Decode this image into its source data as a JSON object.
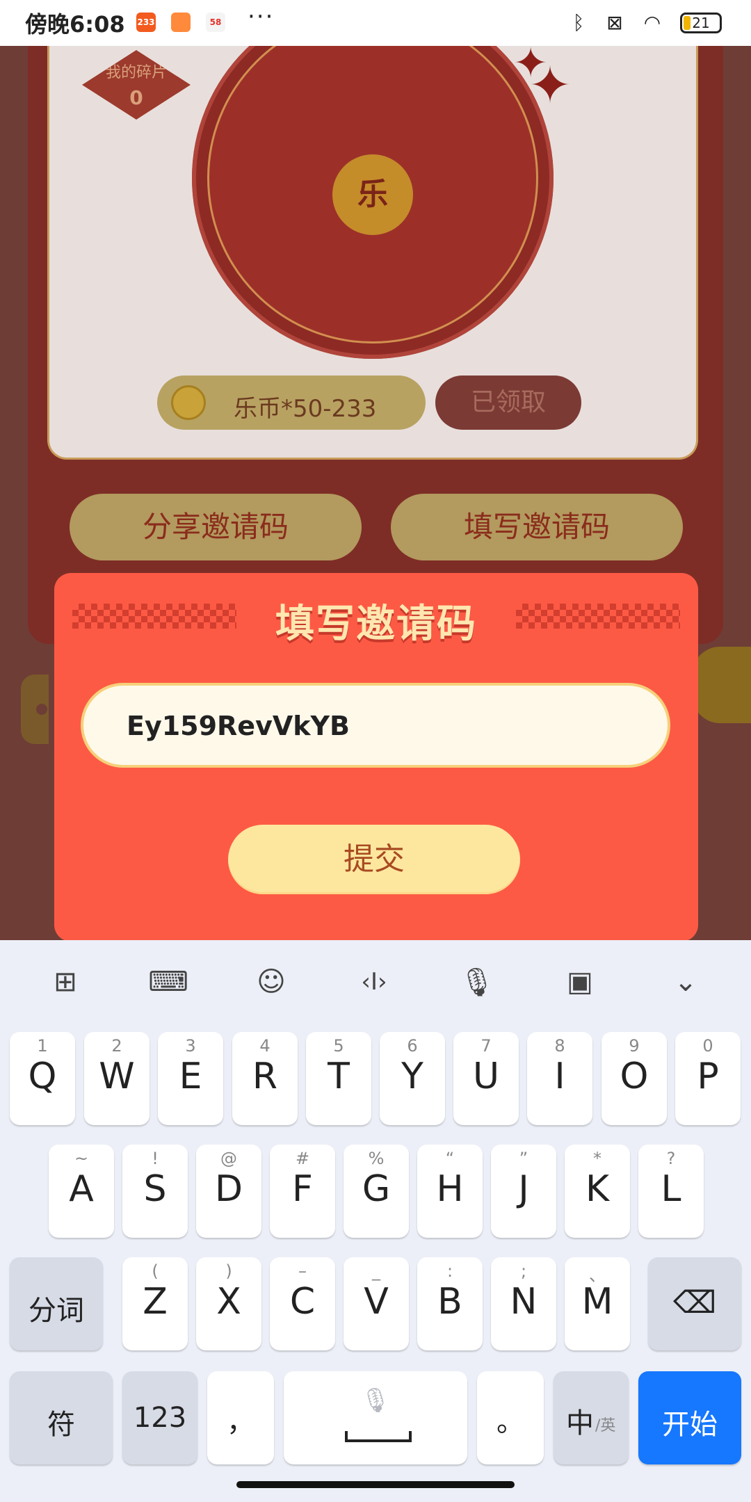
{
  "status_bar": {
    "time": "傍晚6:08",
    "app_icons": [
      {
        "name": "233-app-icon",
        "label": "233",
        "color": "#f25a1e"
      },
      {
        "name": "shopping-bag-icon",
        "label": "",
        "color": "#ff8a3c"
      },
      {
        "name": "58-app-icon",
        "label": "58",
        "color": "#f4f4f4"
      }
    ],
    "more": "···",
    "battery": "21"
  },
  "background": {
    "shards_label": "我的碎片",
    "shards_count": "0",
    "wheel_center": "乐",
    "coin_reward": "乐币*50-233",
    "claimed_label": "已领取",
    "share_invite_label": "分享邀请码",
    "fill_invite_label": "填写邀请码"
  },
  "dialog": {
    "title": "填写邀请码",
    "invite_code_value": "Ey159RevVkYB",
    "submit_label": "提交"
  },
  "keyboard": {
    "toolbar": [
      {
        "name": "apps-grid-icon",
        "glyph": "⊞"
      },
      {
        "name": "keyboard-icon",
        "glyph": "⌨"
      },
      {
        "name": "emoji-icon",
        "glyph": "☺"
      },
      {
        "name": "cursor-icon",
        "glyph": "‹I›"
      },
      {
        "name": "microphone-icon",
        "glyph": "🎙"
      },
      {
        "name": "ad-box-icon",
        "glyph": "▣"
      },
      {
        "name": "collapse-chevron-icon",
        "glyph": "⌄"
      }
    ],
    "row1": [
      {
        "hint": "1",
        "key": "Q"
      },
      {
        "hint": "2",
        "key": "W"
      },
      {
        "hint": "3",
        "key": "E"
      },
      {
        "hint": "4",
        "key": "R"
      },
      {
        "hint": "5",
        "key": "T"
      },
      {
        "hint": "6",
        "key": "Y"
      },
      {
        "hint": "7",
        "key": "U"
      },
      {
        "hint": "8",
        "key": "I"
      },
      {
        "hint": "9",
        "key": "O"
      },
      {
        "hint": "0",
        "key": "P"
      }
    ],
    "row2": [
      {
        "hint": "~",
        "key": "A"
      },
      {
        "hint": "!",
        "key": "S"
      },
      {
        "hint": "@",
        "key": "D"
      },
      {
        "hint": "#",
        "key": "F"
      },
      {
        "hint": "%",
        "key": "G"
      },
      {
        "hint": "“",
        "key": "H"
      },
      {
        "hint": "”",
        "key": "J"
      },
      {
        "hint": "*",
        "key": "K"
      },
      {
        "hint": "?",
        "key": "L"
      }
    ],
    "row3": [
      {
        "hint": "(",
        "key": "Z"
      },
      {
        "hint": ")",
        "key": "X"
      },
      {
        "hint": "–",
        "key": "C"
      },
      {
        "hint": "_",
        "key": "V"
      },
      {
        "hint": ":",
        "key": "B"
      },
      {
        "hint": ";",
        "key": "N"
      },
      {
        "hint": "、",
        "key": "M"
      }
    ],
    "fenci": "分词",
    "symbols": "符",
    "numbers": "123",
    "comma": "，",
    "period": "。",
    "lang_main": "中",
    "lang_sub": "/英",
    "enter": "开始",
    "accent_color": "#1677ff"
  }
}
